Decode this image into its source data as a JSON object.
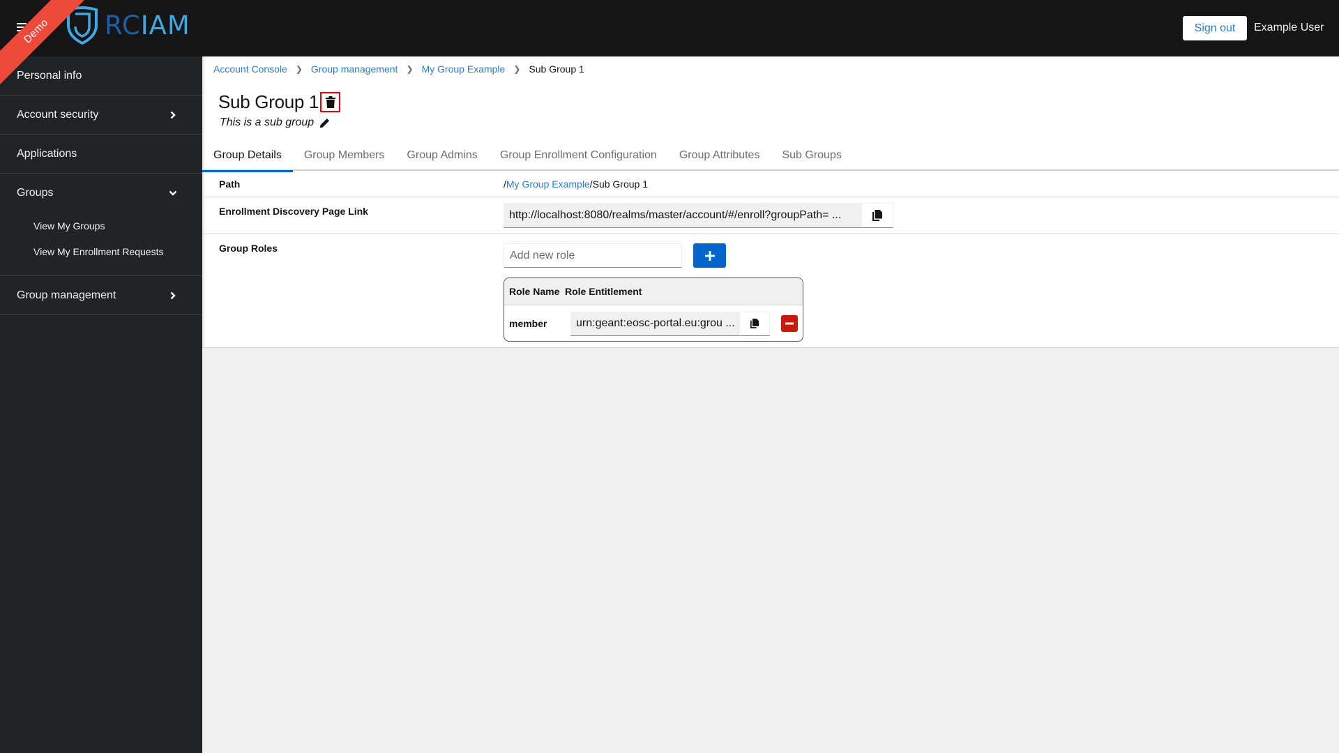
{
  "header": {
    "ribbon_label": "Demo",
    "logo": {
      "part1": "RC",
      "part2": "IAM",
      "color_part1": "#1d5fa8",
      "color_part2": "#3ea8e2"
    },
    "signout_label": "Sign out",
    "username": "Example User"
  },
  "sidebar": {
    "items": [
      {
        "label": "Personal info",
        "has_chevron": false
      },
      {
        "label": "Account security",
        "has_chevron": true,
        "chevron": "right"
      },
      {
        "label": "Applications",
        "has_chevron": false
      },
      {
        "label": "Groups",
        "has_chevron": true,
        "chevron": "down",
        "expanded": true,
        "children": [
          {
            "label": "View My Groups"
          },
          {
            "label": "View My Enrollment Requests"
          }
        ]
      },
      {
        "label": "Group management",
        "has_chevron": true,
        "chevron": "right"
      }
    ]
  },
  "breadcrumb": {
    "items": [
      {
        "label": "Account Console",
        "link": true
      },
      {
        "label": "Group management",
        "link": true
      },
      {
        "label": "My Group Example",
        "link": true
      },
      {
        "label": "Sub Group 1",
        "link": false
      }
    ]
  },
  "page": {
    "title": "Sub Group 1",
    "description": "This is a sub group",
    "delete_icon": "trash-icon",
    "edit_icon": "pencil-icon"
  },
  "tabs": [
    {
      "label": "Group Details",
      "active": true
    },
    {
      "label": "Group Members",
      "active": false
    },
    {
      "label": "Group Admins",
      "active": false
    },
    {
      "label": "Group Enrollment Configuration",
      "active": false
    },
    {
      "label": "Group Attributes",
      "active": false
    },
    {
      "label": "Sub Groups",
      "active": false
    }
  ],
  "details": {
    "path": {
      "label": "Path",
      "prefix": "/",
      "link_part": "My Group Example",
      "suffix": "/Sub Group 1"
    },
    "enrollment_link": {
      "label": "Enrollment Discovery Page Link",
      "value": "http://localhost:8080/realms/master/account/#/enroll?groupPath= ...",
      "copy_icon": "copy-icon"
    },
    "group_roles": {
      "label": "Group Roles",
      "input_placeholder": "Add new role",
      "input_value": "",
      "add_icon": "plus-icon",
      "table": {
        "headers": [
          "Role Name",
          "Role Entitlement"
        ],
        "rows": [
          {
            "role_name": "member",
            "entitlement": "urn:geant:eosc-portal.eu:grou ..."
          }
        ]
      }
    }
  },
  "colors": {
    "accent": "#0066cc",
    "link": "#2b7cd3",
    "danger": "#c9190b",
    "header_bg": "#151515",
    "sidebar_bg": "#212427",
    "ribbon": "#ee4a3a"
  }
}
